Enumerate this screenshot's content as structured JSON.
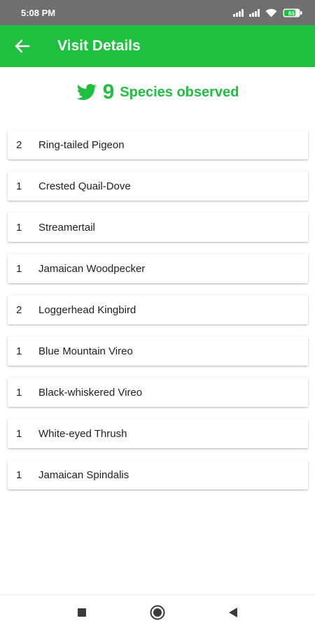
{
  "status_bar": {
    "time": "5:08 PM",
    "battery": "66"
  },
  "app_bar": {
    "title": "Visit Details",
    "back_icon": "arrow-left-icon"
  },
  "summary": {
    "icon": "bird-icon",
    "count": "9",
    "label": "Species observed"
  },
  "species": [
    {
      "qty": "2",
      "name": "Ring-tailed Pigeon"
    },
    {
      "qty": "1",
      "name": "Crested Quail-Dove"
    },
    {
      "qty": "1",
      "name": "Streamertail"
    },
    {
      "qty": "1",
      "name": "Jamaican Woodpecker"
    },
    {
      "qty": "2",
      "name": "Loggerhead Kingbird"
    },
    {
      "qty": "1",
      "name": "Blue Mountain Vireo"
    },
    {
      "qty": "1",
      "name": "Black-whiskered Vireo"
    },
    {
      "qty": "1",
      "name": "White-eyed Thrush"
    },
    {
      "qty": "1",
      "name": "Jamaican Spindalis"
    }
  ],
  "nav_bar": {
    "icons": [
      "recents-square-icon",
      "home-circle-icon",
      "back-triangle-icon"
    ]
  },
  "colors": {
    "accent": "#1fbf3f",
    "status_bar": "#6f6f6f",
    "text": "#212121"
  }
}
